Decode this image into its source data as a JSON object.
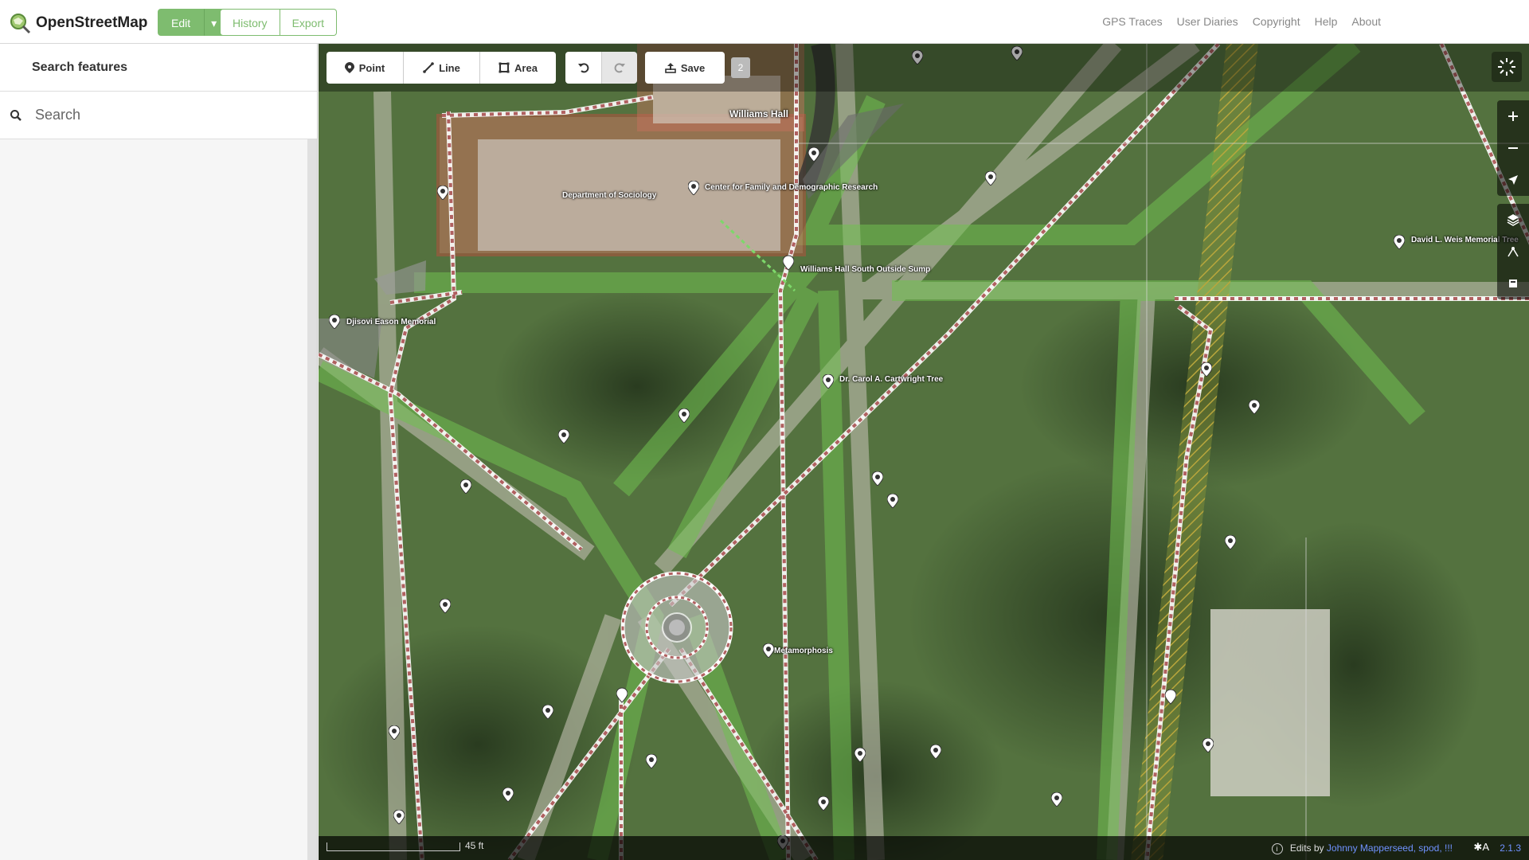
{
  "header": {
    "brand": "OpenStreetMap",
    "edit_label": "Edit",
    "history_label": "History",
    "export_label": "Export",
    "nav": [
      "GPS Traces",
      "User Diaries",
      "Copyright",
      "Help",
      "About"
    ]
  },
  "sidebar": {
    "title": "Search features",
    "search_placeholder": "Search"
  },
  "toolbar": {
    "point_label": "Point",
    "line_label": "Line",
    "area_label": "Area",
    "save_label": "Save",
    "save_count": "2"
  },
  "map": {
    "labels": {
      "williams_hall": "Williams Hall",
      "dept_sociology": "Department of Sociology",
      "center_family": "Center for Family and Demographic Research",
      "sump": "Williams Hall South Outside Sump",
      "djisovi": "Djisovi Eason Memorial",
      "cartwright": "Dr. Carol A. Cartwright Tree",
      "weis": "David L. Weis Memorial Tree",
      "metamorphosis": "Metamorphosis"
    },
    "scale_label": "45 ft",
    "attribution_prefix": "Edits by",
    "attribution_users": "Johnny Mapperseed, spod, !!!",
    "version": "2.1.3"
  },
  "colors": {
    "brand_green": "#7ebc6f",
    "path_red": "#c98a8a",
    "grass_green": "#69a84f"
  }
}
